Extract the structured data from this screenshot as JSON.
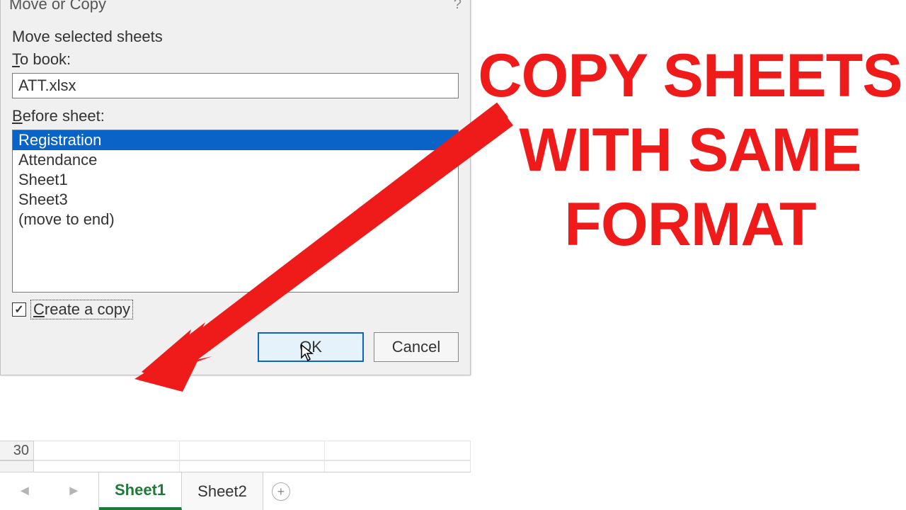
{
  "dialog": {
    "title": "Move or Copy",
    "help_marker": "?",
    "move_label": "Move selected sheets",
    "to_book_label": "To book:",
    "to_book_value": "ATT.xlsx",
    "before_sheet_label": "Before sheet:",
    "sheets": [
      "Registration",
      "Attendance",
      "Sheet1",
      "Sheet3",
      "(move to end)"
    ],
    "selected_index": 0,
    "create_copy_label": "Create a copy",
    "create_copy_checked": true,
    "ok_label": "OK",
    "cancel_label": "Cancel"
  },
  "grid": {
    "row_number": "30"
  },
  "tabs": {
    "items": [
      "Sheet1",
      "Sheet2"
    ],
    "active_index": 0
  },
  "overlay": {
    "line1": "COPY SHEETS",
    "line2": "WITH SAME",
    "line3": "FORMAT"
  }
}
